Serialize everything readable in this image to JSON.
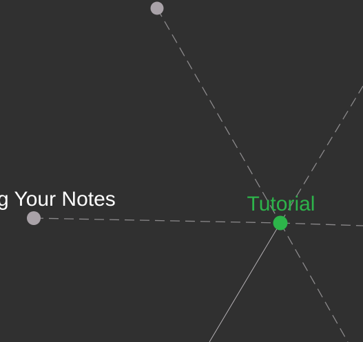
{
  "graph": {
    "nodes": [
      {
        "id": "partial-label-node",
        "label": "g Your Notes",
        "color": "#a9a2a8",
        "label_color": "#ffffff"
      },
      {
        "id": "tutorial-node",
        "label": "Tutorial",
        "color": "#2db44a",
        "label_color": "#2db44a"
      },
      {
        "id": "top-node",
        "label": "",
        "color": "#a9a2a8"
      }
    ],
    "background_color": "#303030",
    "link_color": "#8c8a8c"
  }
}
